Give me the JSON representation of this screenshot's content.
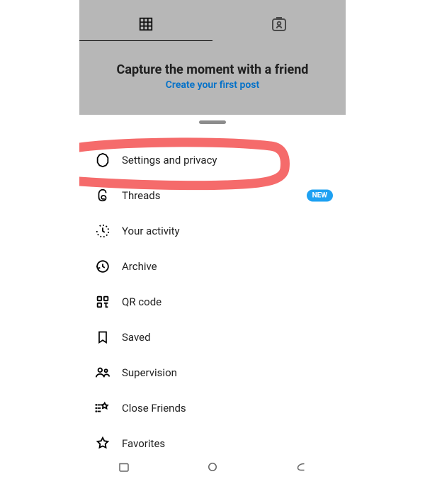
{
  "background": {
    "heading": "Capture the moment with a friend",
    "link": "Create your first post"
  },
  "badge_new": "NEW",
  "menu": {
    "settings": "Settings and privacy",
    "threads": "Threads",
    "activity": "Your activity",
    "archive": "Archive",
    "qrcode": "QR code",
    "saved": "Saved",
    "supervision": "Supervision",
    "close_friends": "Close Friends",
    "favorites": "Favorites"
  }
}
